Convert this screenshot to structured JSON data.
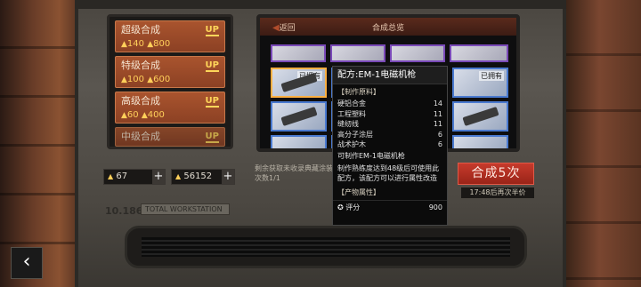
{
  "tiers": [
    {
      "name": "超级合成",
      "cost_a": "140",
      "cost_b": "800",
      "badge": "UP"
    },
    {
      "name": "特级合成",
      "cost_a": "100",
      "cost_b": "600",
      "badge": "UP"
    },
    {
      "name": "高级合成",
      "cost_a": "60",
      "cost_b": "400",
      "badge": "UP"
    },
    {
      "name": "中级合成",
      "badge": "UP"
    }
  ],
  "counters": {
    "parts": "67",
    "metal": "56152",
    "parts_icon": "blueprint-icon",
    "metal_icon": "ore-icon"
  },
  "display": {
    "back_label": "返回",
    "title": "合成总览",
    "owned_label": "已拥有"
  },
  "hint_text": "剩余获取未收录典藏涂装次数1/1",
  "synth_button": "合成5次",
  "timer": "17:48后再次半价",
  "plate_number": "10.186",
  "plate_text": "TOTAL WORKSTATION",
  "tooltip": {
    "title": "配方:EM-1电磁机枪",
    "materials_header": "【制作原料】",
    "materials": [
      {
        "name": "硬铝合金",
        "qty": "14"
      },
      {
        "name": "工程塑料",
        "qty": "11"
      },
      {
        "name": "缝纫线",
        "qty": "11"
      },
      {
        "name": "高分子涂层",
        "qty": "6"
      },
      {
        "name": "战术护木",
        "qty": "6"
      }
    ],
    "desc1": "可制作EM-1电磁机枪",
    "desc2": "制作熟练度达到48级后可使用此配方，该配方可以进行属性改造",
    "product_header": "【产物属性】",
    "score_label": "评分",
    "score_value": "900"
  },
  "colors": {
    "accent": "#a9542e",
    "gold": "#ffcf5a",
    "synth_red": "#c63a2c",
    "purple_rarity": "#7a4ab8",
    "blue_rarity": "#4a7ad0",
    "selected": "#ffb042"
  }
}
